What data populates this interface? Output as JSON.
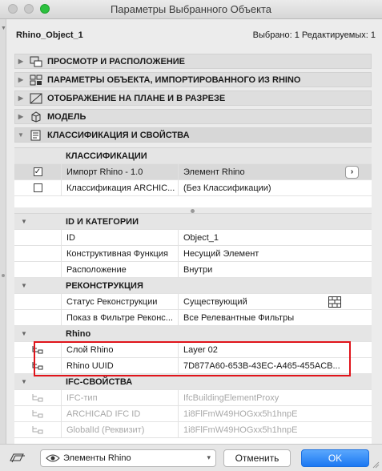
{
  "window": {
    "title": "Параметры Выбранного Объекта"
  },
  "object": {
    "name": "Rhino_Object_1",
    "selection_info": "Выбрано: 1 Редактируемых: 1"
  },
  "sections": [
    {
      "label": "ПРОСМОТР И РАСПОЛОЖЕНИЕ",
      "icon": "preview-position-icon",
      "expanded": false
    },
    {
      "label": "ПАРАМЕТРЫ ОБЪЕКТА, ИМПОРТИРОВАННОГО ИЗ RHINO",
      "icon": "object-params-icon",
      "expanded": false
    },
    {
      "label": "ОТОБРАЖЕНИЕ НА ПЛАНЕ И В РАЗРЕЗЕ",
      "icon": "plan-section-icon",
      "expanded": false
    },
    {
      "label": "МОДЕЛЬ",
      "icon": "model-icon",
      "expanded": false
    },
    {
      "label": "КЛАССИФИКАЦИЯ И СВОЙСТВА",
      "icon": "classification-icon",
      "expanded": true
    }
  ],
  "classifications": {
    "header": "КЛАССИФИКАЦИИ",
    "rows": [
      {
        "checked": true,
        "name": "Импорт Rhino - 1.0",
        "value": "Элемент Rhino",
        "arrow": "›"
      },
      {
        "checked": false,
        "name": "Классификация ARCHIC...",
        "value": "(Без Классификации)"
      }
    ]
  },
  "properties": {
    "groups": [
      {
        "title": "ID И КАТЕГОРИИ",
        "rows": [
          {
            "name": "ID",
            "value": "Object_1"
          },
          {
            "name": "Конструктивная Функция",
            "value": "Несущий Элемент"
          },
          {
            "name": "Расположение",
            "value": "Внутри"
          }
        ]
      },
      {
        "title": "РЕКОНСТРУКЦИЯ",
        "rows": [
          {
            "name": "Статус Реконструкции",
            "value": "Существующий"
          },
          {
            "name": "Показ в Фильтре Реконс...",
            "value": "Все Релевантные Фильтры"
          }
        ]
      },
      {
        "title": "Rhino",
        "rows": [
          {
            "name": "Слой Rhino",
            "value": "Layer 02"
          },
          {
            "name": "Rhino UUID",
            "value": "7D877A60-653B-43EC-A465-455ACB..."
          }
        ]
      },
      {
        "title": "IFC-СВОЙСТВА",
        "rows": [
          {
            "name": "IFC-тип",
            "value": "IfcBuildingElementProxy"
          },
          {
            "name": "ARCHICAD IFC ID",
            "value": "1i8FlFmW49HOGxx5h1hnpE"
          },
          {
            "name": "GlobalId (Реквизит)",
            "value": "1i8FlFmW49HOGxx5h1hnpE"
          }
        ]
      }
    ]
  },
  "footer": {
    "filter_value": "Элементы Rhino",
    "cancel_label": "Отменить",
    "ok_label": "OK"
  },
  "colors": {
    "accent": "#1b78f2",
    "highlight_box": "#e0141b"
  }
}
